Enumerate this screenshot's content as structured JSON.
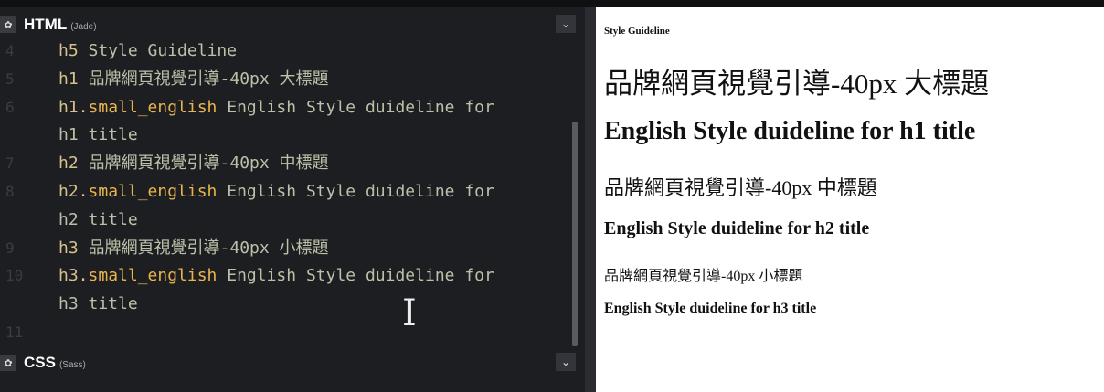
{
  "html_pane": {
    "title": "HTML",
    "subtitle": "(Jade)",
    "gear": "gear-icon",
    "chevron": "chevron-down-icon"
  },
  "css_pane": {
    "title": "CSS",
    "subtitle": "(Sass)"
  },
  "code_lines": [
    {
      "num": "4",
      "tag": "h5",
      "cls": "",
      "text": " Style Guideline"
    },
    {
      "num": "5",
      "tag": "h1",
      "cls": "",
      "text": " 品牌網頁視覺引導-40px 大標題"
    },
    {
      "num": "6",
      "tag": "h1.",
      "cls": "small_english",
      "text": " English Style duideline for"
    },
    {
      "num": "",
      "tag": "",
      "cls": "",
      "text": "h1 title"
    },
    {
      "num": "7",
      "tag": "h2",
      "cls": "",
      "text": " 品牌網頁視覺引導-40px 中標題"
    },
    {
      "num": "8",
      "tag": "h2.",
      "cls": "small_english",
      "text": " English Style duideline for"
    },
    {
      "num": "",
      "tag": "",
      "cls": "",
      "text": "h2 title"
    },
    {
      "num": "9",
      "tag": "h3",
      "cls": "",
      "text": " 品牌網頁視覺引導-40px 小標題"
    },
    {
      "num": "10",
      "tag": "h3.",
      "cls": "small_english",
      "text": " English Style duideline for"
    },
    {
      "num": "",
      "tag": "",
      "cls": "",
      "text": "h3 title"
    },
    {
      "num": "11",
      "tag": "",
      "cls": "",
      "text": ""
    }
  ],
  "preview": {
    "h5": "Style Guideline",
    "h1_zh": "品牌網頁視覺引導-40px 大標題",
    "h1_en": "English Style duideline for h1 title",
    "h2_zh": "品牌網頁視覺引導-40px 中標題",
    "h2_en": "English Style duideline for h2 title",
    "h3_zh": "品牌網頁視覺引導-40px 小標題",
    "h3_en": "English Style duideline for h3 title"
  }
}
